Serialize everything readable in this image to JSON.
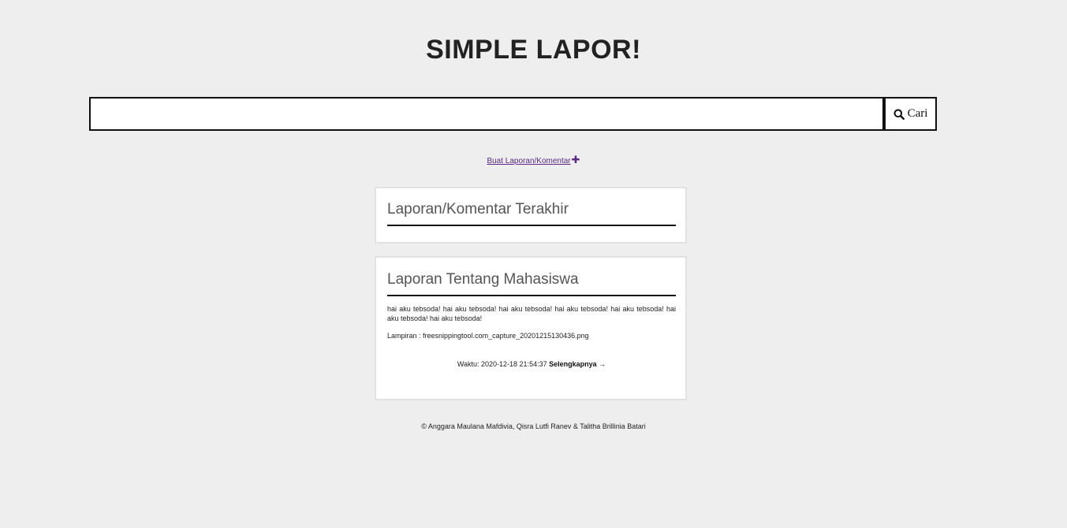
{
  "app": {
    "title": "SIMPLE LAPOR!"
  },
  "search": {
    "value": "",
    "placeholder": "",
    "button_label": "Cari",
    "icon": "search-icon"
  },
  "actions": {
    "create_label": "Buat Laporan/Komentar",
    "create_icon": "plus-icon"
  },
  "latest_section": {
    "heading": "Laporan/Komentar Terakhir"
  },
  "report_card": {
    "heading": "Laporan Tentang Mahasiswa",
    "text": "hai aku tebsoda! hai aku tebsoda! hai aku tebsoda! hai aku tebsoda! hai aku tebsoda! hai aku tebsoda! hai aku tebsoda!",
    "attachment": "Lampiran : freesnippingtool.com_capture_20201215130436.png",
    "time": "Waktu: 2020-12-18 21:54:37",
    "more_label": "Selengkapnya →"
  },
  "footer": {
    "credit": "© Anggara Maulana Mafdivia, Qisra Lutfi Ranev & Talitha Brillinia Batari"
  },
  "colors": {
    "background": "#eeeeee",
    "link": "#5b2a86",
    "card": "#ffffff"
  }
}
